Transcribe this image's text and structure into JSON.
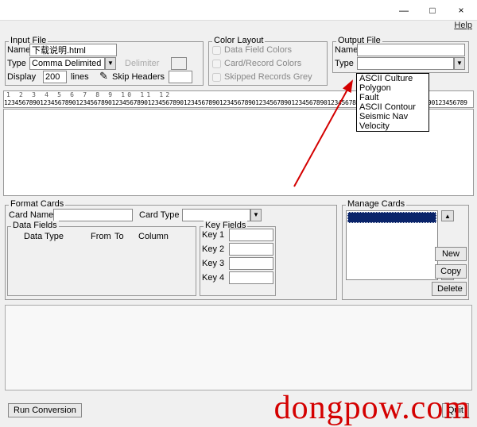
{
  "titlebar": {
    "min": "—",
    "max": "□",
    "close": "×"
  },
  "menubar": {
    "help": "Help"
  },
  "input_file": {
    "legend": "Input File",
    "name_lbl": "Name",
    "name_val": "下载说明.html",
    "type_lbl": "Type",
    "type_val": "Comma Delimited",
    "delimiter_lbl": "Delimiter",
    "display_lbl": "Display",
    "display_val": "200",
    "lines_lbl": "lines",
    "skip_lbl": "Skip Headers",
    "skip_val": ""
  },
  "color_layout": {
    "legend": "Color Layout",
    "c1": "Data Field Colors",
    "c2": "Card/Record Colors",
    "c3": "Skipped Records Grey"
  },
  "output_file": {
    "legend": "Output File",
    "name_lbl": "Name",
    "name_val": "",
    "type_lbl": "Type",
    "type_val": "",
    "options": [
      "ASCII Culture",
      "Polygon",
      "Fault",
      "ASCII Contour",
      "Seismic Nav",
      "Velocity"
    ]
  },
  "ruler": {
    "nums": "1 2 3 4 5 6 7 8 9 10 11 12",
    "ticks": "123456789012345678901234567890123456789012345678901234567890123456789012345678901234567890123456789012345678901234567890123456789"
  },
  "format_cards": {
    "legend": "Format Cards",
    "cardname_lbl": "Card Name",
    "cardname_val": "",
    "cardtype_lbl": "Card Type",
    "cardtype_val": "",
    "data_fields_legend": "Data Fields",
    "h1": "Data Type",
    "h2": "From",
    "h3": "To",
    "h4": "Column",
    "key_fields_legend": "Key Fields",
    "k1": "Key 1",
    "k2": "Key 2",
    "k3": "Key 3",
    "k4": "Key 4"
  },
  "manage_cards": {
    "legend": "Manage Cards",
    "new": "New",
    "copy": "Copy",
    "delete": "Delete"
  },
  "run": "Run Conversion",
  "quit": "Quit",
  "watermark": "dongpow.com"
}
